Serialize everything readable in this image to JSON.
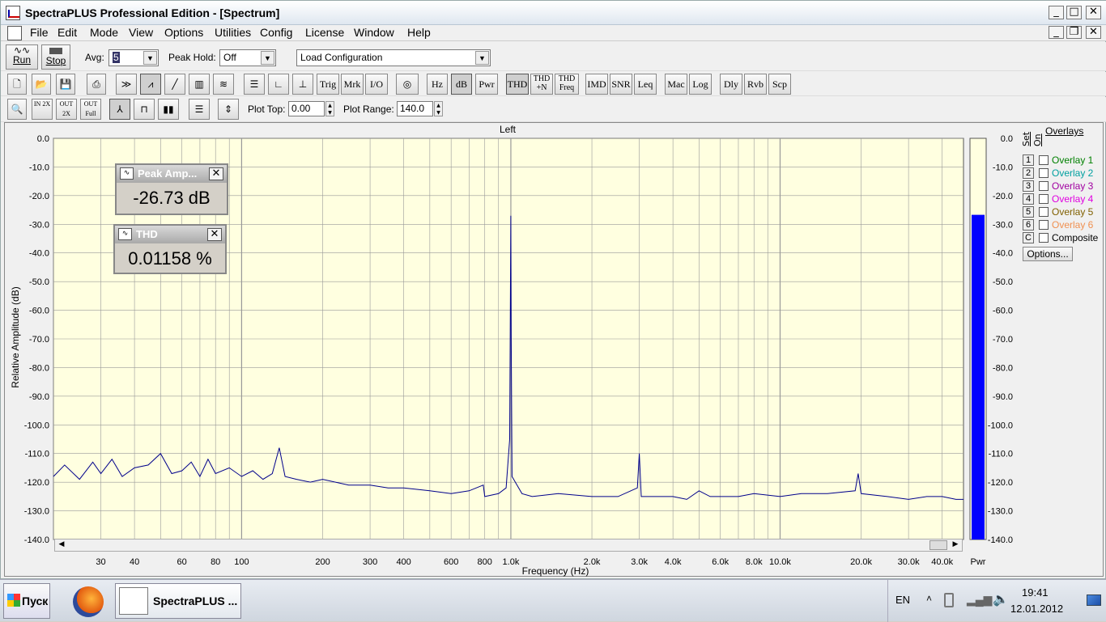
{
  "window": {
    "title": "SpectraPLUS Professional Edition - [Spectrum]",
    "menu": [
      "File",
      "Edit",
      "Mode",
      "View",
      "Options",
      "Utilities",
      "Config",
      "License",
      "Window",
      "Help"
    ]
  },
  "toolbar1": {
    "run_label": "Run",
    "stop_label": "Stop",
    "avg_label": "Avg:",
    "avg_value": "5",
    "peakhold_label": "Peak Hold:",
    "peakhold_value": "Off",
    "config_value": "Load Configuration"
  },
  "toolbar2": {
    "buttons": [
      "Trig",
      "Mrk",
      "I/O",
      "Hz",
      "dB",
      "Pwr",
      "THD",
      "THD +N",
      "THD Freq",
      "IMD",
      "SNR",
      "Leq",
      "Mac",
      "Log",
      "Dly",
      "Rvb",
      "Scp"
    ]
  },
  "toolbar3": {
    "plot_top_label": "Plot Top:",
    "plot_top_value": "0.00",
    "plot_range_label": "Plot Range:",
    "plot_range_value": "140.0"
  },
  "overlays": {
    "title": "Overlays",
    "set_label": "Set",
    "on_label": "On",
    "items": [
      {
        "n": "1",
        "label": "Overlay 1",
        "color": "#008000"
      },
      {
        "n": "2",
        "label": "Overlay 2",
        "color": "#00a0a0"
      },
      {
        "n": "3",
        "label": "Overlay 3",
        "color": "#a000a0"
      },
      {
        "n": "4",
        "label": "Overlay 4",
        "color": "#e000e0"
      },
      {
        "n": "5",
        "label": "Overlay 5",
        "color": "#806000"
      },
      {
        "n": "6",
        "label": "Overlay 6",
        "color": "#f09050"
      },
      {
        "n": "C",
        "label": "Composite",
        "color": "#000000"
      }
    ],
    "options_label": "Options..."
  },
  "readouts": {
    "peak_title": "Peak Amp...",
    "peak_value": "-26.73 dB",
    "thd_title": "THD",
    "thd_value": "0.01158 %"
  },
  "chart_data": {
    "type": "line",
    "title": "Left",
    "xlabel": "Frequency (Hz)",
    "ylabel": "Relative Amplitude (dB)",
    "xscale": "log",
    "xlim": [
      20,
      48000
    ],
    "ylim": [
      -140,
      0
    ],
    "grid": true,
    "plot_bg": "#ffffe0",
    "line_color": "#00008b",
    "yticks": [
      "0.0",
      "-10.0",
      "-20.0",
      "-30.0",
      "-40.0",
      "-50.0",
      "-60.0",
      "-70.0",
      "-80.0",
      "-90.0",
      "-100.0",
      "-110.0",
      "-120.0",
      "-130.0",
      "-140.0"
    ],
    "xticks": [
      {
        "v": 30,
        "label": "30"
      },
      {
        "v": 40,
        "label": "40"
      },
      {
        "v": 60,
        "label": "60"
      },
      {
        "v": 80,
        "label": "80"
      },
      {
        "v": 100,
        "label": "100"
      },
      {
        "v": 200,
        "label": "200"
      },
      {
        "v": 300,
        "label": "300"
      },
      {
        "v": 400,
        "label": "400"
      },
      {
        "v": 600,
        "label": "600"
      },
      {
        "v": 800,
        "label": "800"
      },
      {
        "v": 1000,
        "label": "1.0k"
      },
      {
        "v": 2000,
        "label": "2.0k"
      },
      {
        "v": 3000,
        "label": "3.0k"
      },
      {
        "v": 4000,
        "label": "4.0k"
      },
      {
        "v": 6000,
        "label": "6.0k"
      },
      {
        "v": 8000,
        "label": "8.0k"
      },
      {
        "v": 10000,
        "label": "10.0k"
      },
      {
        "v": 20000,
        "label": "20.0k"
      },
      {
        "v": 30000,
        "label": "30.0k"
      },
      {
        "v": 40000,
        "label": "40.0k"
      }
    ],
    "series": [
      {
        "points": [
          [
            20,
            -118
          ],
          [
            22,
            -114
          ],
          [
            25,
            -119
          ],
          [
            28,
            -113
          ],
          [
            30,
            -117
          ],
          [
            33,
            -112
          ],
          [
            36,
            -118
          ],
          [
            40,
            -115
          ],
          [
            45,
            -114
          ],
          [
            50,
            -110
          ],
          [
            55,
            -117
          ],
          [
            60,
            -116
          ],
          [
            65,
            -113
          ],
          [
            70,
            -118
          ],
          [
            75,
            -112
          ],
          [
            80,
            -117
          ],
          [
            90,
            -115
          ],
          [
            100,
            -118
          ],
          [
            110,
            -116
          ],
          [
            120,
            -119
          ],
          [
            130,
            -117
          ],
          [
            138,
            -108
          ],
          [
            145,
            -118
          ],
          [
            160,
            -119
          ],
          [
            180,
            -120
          ],
          [
            200,
            -119
          ],
          [
            250,
            -121
          ],
          [
            300,
            -121
          ],
          [
            350,
            -122
          ],
          [
            400,
            -122
          ],
          [
            500,
            -123
          ],
          [
            600,
            -124
          ],
          [
            700,
            -123
          ],
          [
            790,
            -121
          ],
          [
            800,
            -125
          ],
          [
            900,
            -124
          ],
          [
            960,
            -122
          ],
          [
            990,
            -105
          ],
          [
            1000,
            -27
          ],
          [
            1003,
            -70
          ],
          [
            1010,
            -118
          ],
          [
            1100,
            -124
          ],
          [
            1200,
            -125
          ],
          [
            1500,
            -124
          ],
          [
            2000,
            -125
          ],
          [
            2500,
            -125
          ],
          [
            2950,
            -122
          ],
          [
            3000,
            -110
          ],
          [
            3050,
            -125
          ],
          [
            3500,
            -125
          ],
          [
            4000,
            -125
          ],
          [
            4500,
            -126
          ],
          [
            5000,
            -123
          ],
          [
            5500,
            -125
          ],
          [
            6000,
            -125
          ],
          [
            7000,
            -125
          ],
          [
            8000,
            -124
          ],
          [
            10000,
            -125
          ],
          [
            12000,
            -124
          ],
          [
            15000,
            -124
          ],
          [
            19000,
            -123
          ],
          [
            19500,
            -117
          ],
          [
            20000,
            -124
          ],
          [
            25000,
            -125
          ],
          [
            30000,
            -126
          ],
          [
            35000,
            -125
          ],
          [
            40000,
            -125
          ],
          [
            45000,
            -126
          ],
          [
            48000,
            -126
          ]
        ]
      }
    ],
    "meter": {
      "label": "Pwr",
      "value_db": -26.7,
      "color": "#0000ff"
    }
  },
  "taskbar": {
    "start_label": "Пуск",
    "task_label": "SpectraPLUS ...",
    "lang": "EN",
    "time": "19:41",
    "date": "12.01.2012"
  }
}
